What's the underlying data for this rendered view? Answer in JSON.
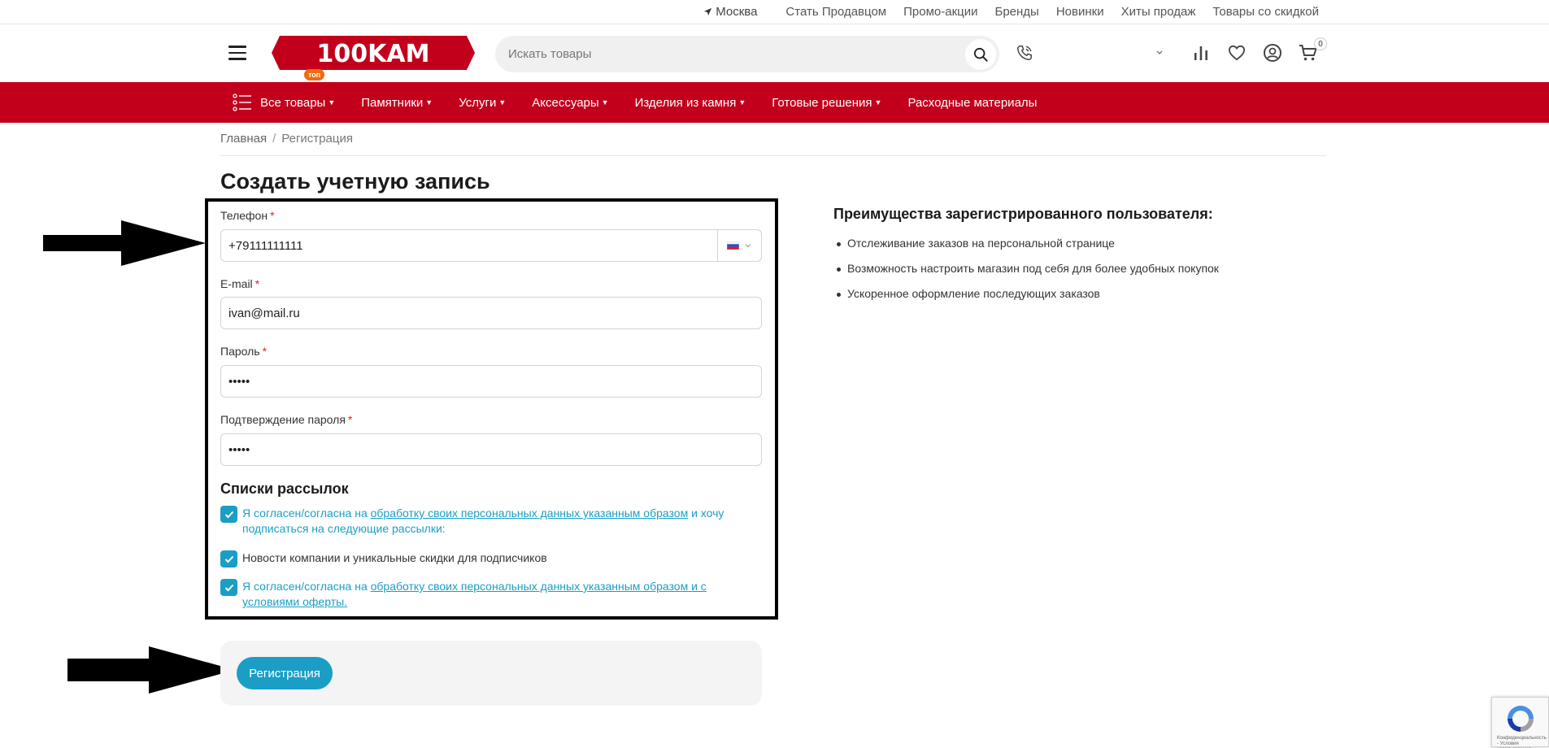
{
  "topbar": {
    "city": "Москва",
    "links": [
      "Стать Продавцом",
      "Промо-акции",
      "Бренды",
      "Новинки",
      "Хиты продаж",
      "Товары со скидкой"
    ]
  },
  "header": {
    "logo_text": "100KAM",
    "search_placeholder": "Искать товары",
    "cart_count": "0"
  },
  "nav": {
    "all_label": "Все товары",
    "top_badge": "топ",
    "items": [
      "Памятники",
      "Услуги",
      "Аксессуары",
      "Изделия из камня",
      "Готовые решения",
      "Расходные материалы"
    ]
  },
  "breadcrumb": {
    "home": "Главная",
    "current": "Регистрация"
  },
  "page_title": "Создать учетную запись",
  "form": {
    "phone_label": "Телефон",
    "phone_value": "+79111111111",
    "email_label": "E-mail",
    "email_value": "ivan@mail.ru",
    "password_label": "Пароль",
    "password_value": "•••••",
    "confirm_label": "Подтверждение пароля",
    "confirm_value": "•••••",
    "required_mark": "*"
  },
  "mailing": {
    "title": "Списки рассылок",
    "consent1_prefix": "Я согласен/согласна на ",
    "consent1_link": "обработку своих персональных данных указанным образом",
    "consent1_suffix": " и хочу подписаться на следующие рассылки:",
    "news": "Новости компании и уникальные скидки для подписчиков",
    "consent2_prefix": "Я согласен/согласна на ",
    "consent2_link": "обработку своих персональных данных указанным образом и с условиями оферты."
  },
  "submit_label": "Регистрация",
  "benefits": {
    "title": "Преимущества зарегистрированного пользователя:",
    "items": [
      "Отслеживание заказов на персональной странице",
      "Возможность настроить магазин под себя для более удобных покупок",
      "Ускоренное оформление последующих заказов"
    ]
  },
  "recaptcha_text": "Конфиденциальность - Условия использования",
  "colors": {
    "brand_red": "#c3001c",
    "accent_blue": "#1a9ec6"
  }
}
